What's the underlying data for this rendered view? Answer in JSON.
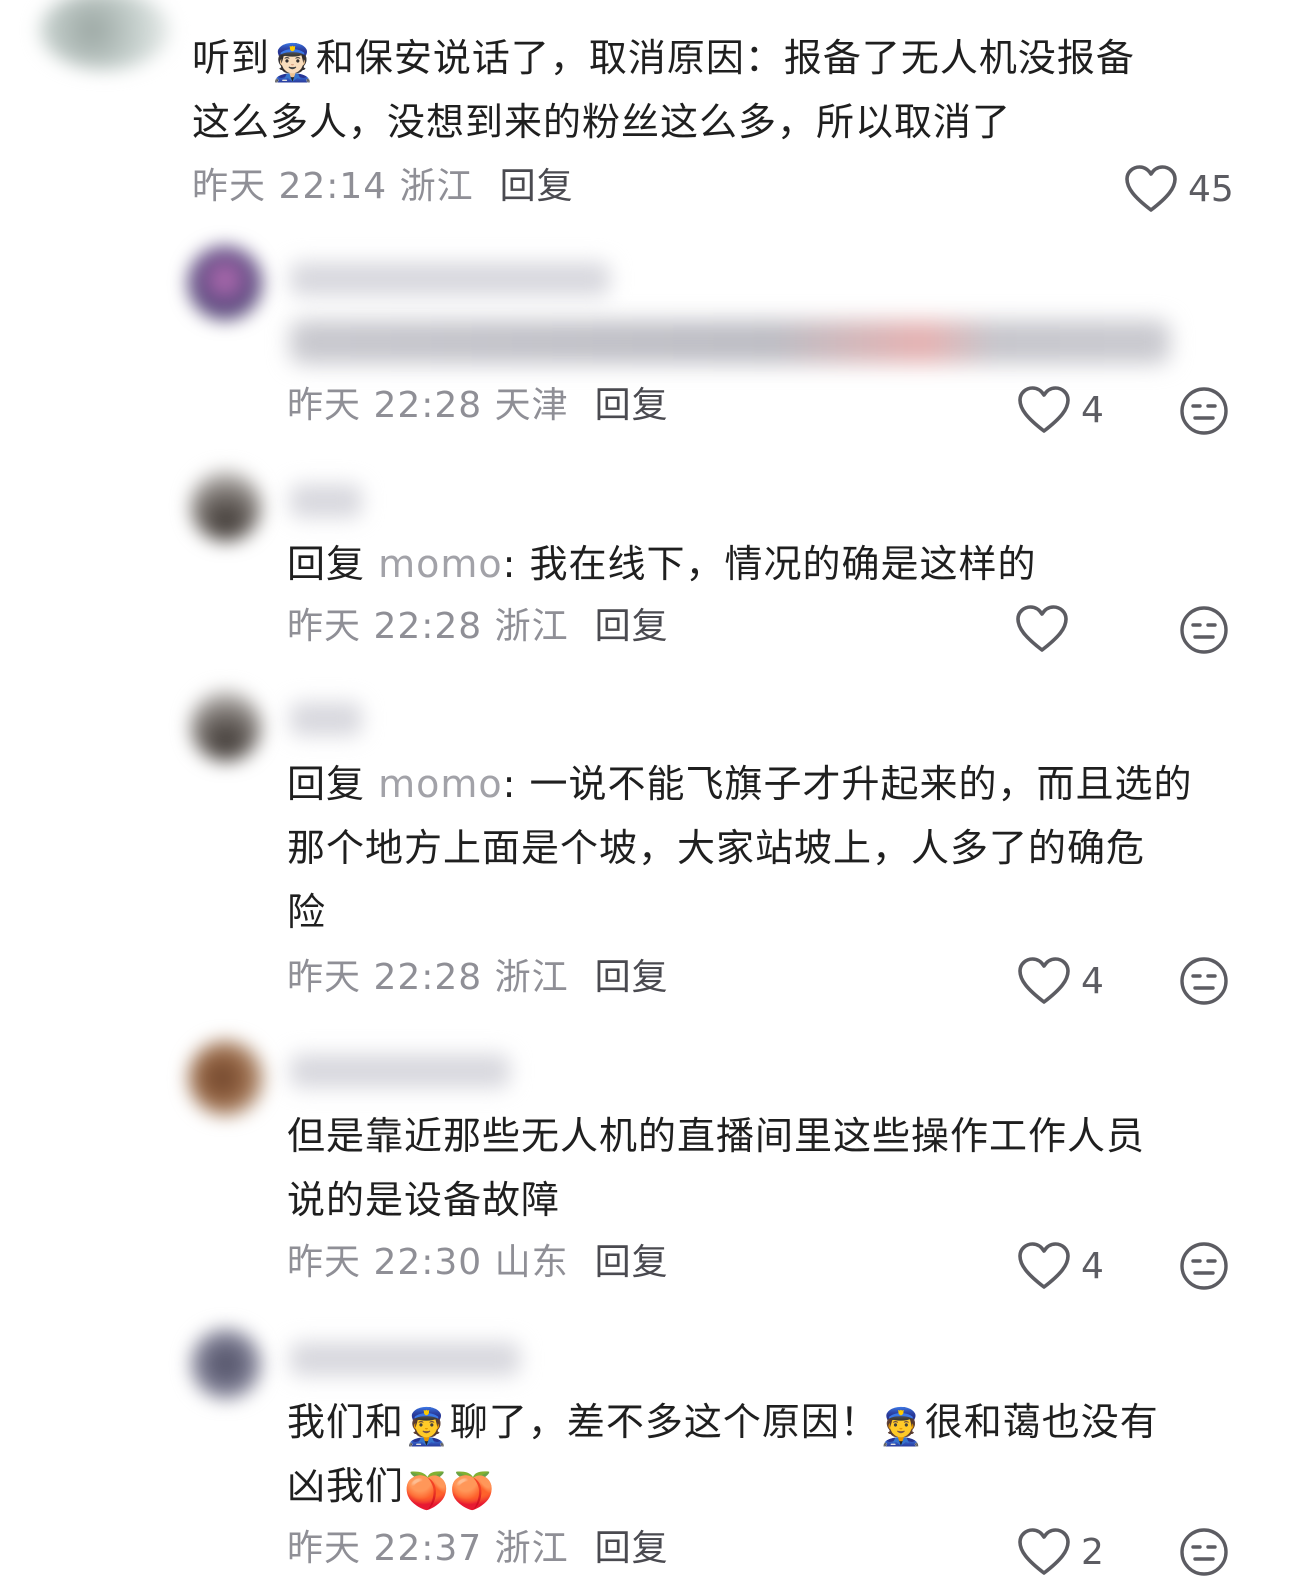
{
  "comments": [
    {
      "text_parts": [
        "听到",
        "和保安说话了，取消原因：报备了无人机没报备",
        "这么多人，没想到来的粉丝这么多，所以取消了"
      ],
      "emoji_1": "👮🏻",
      "meta": {
        "time": "昨天 22:14 浙江",
        "reply": "回复"
      },
      "likes": "45"
    },
    {
      "meta": {
        "time": "昨天 22:28 天津",
        "reply": "回复"
      },
      "likes": "4"
    },
    {
      "reply_prefix": "回复",
      "reply_user": "momo",
      "text": ": 我在线下，情况的确是这样的",
      "meta": {
        "time": "昨天 22:28 浙江",
        "reply": "回复"
      },
      "likes": ""
    },
    {
      "reply_prefix": "回复",
      "reply_user": "momo",
      "lines": [
        ": 一说不能飞旗子才升起来的，而且选的",
        "那个地方上面是个坡，大家站坡上，人多了的确危",
        "险"
      ],
      "meta": {
        "time": "昨天 22:28 浙江",
        "reply": "回复"
      },
      "likes": "4"
    },
    {
      "lines": [
        "但是靠近那些无人机的直播间里这些操作工作人员",
        "说的是设备故障"
      ],
      "meta": {
        "time": "昨天 22:30 山东",
        "reply": "回复"
      },
      "likes": "4"
    },
    {
      "line1_parts": [
        "我们和",
        "聊了，差不多这个原因！",
        "很和蔼也没有"
      ],
      "line2_text": "凶我们",
      "emoji_police": "👮",
      "emoji_peach": "🍑",
      "meta": {
        "time": "昨天 22:37 浙江",
        "reply": "回复"
      },
      "likes": "2"
    }
  ],
  "icons": {
    "like": "heart-outline-icon",
    "dislike": "neutral-face-icon"
  },
  "colors": {
    "text": "#1f1f1f",
    "meta": "#8f8f96",
    "reply_user": "#a2a2a8",
    "icon": "#5c5c62"
  }
}
